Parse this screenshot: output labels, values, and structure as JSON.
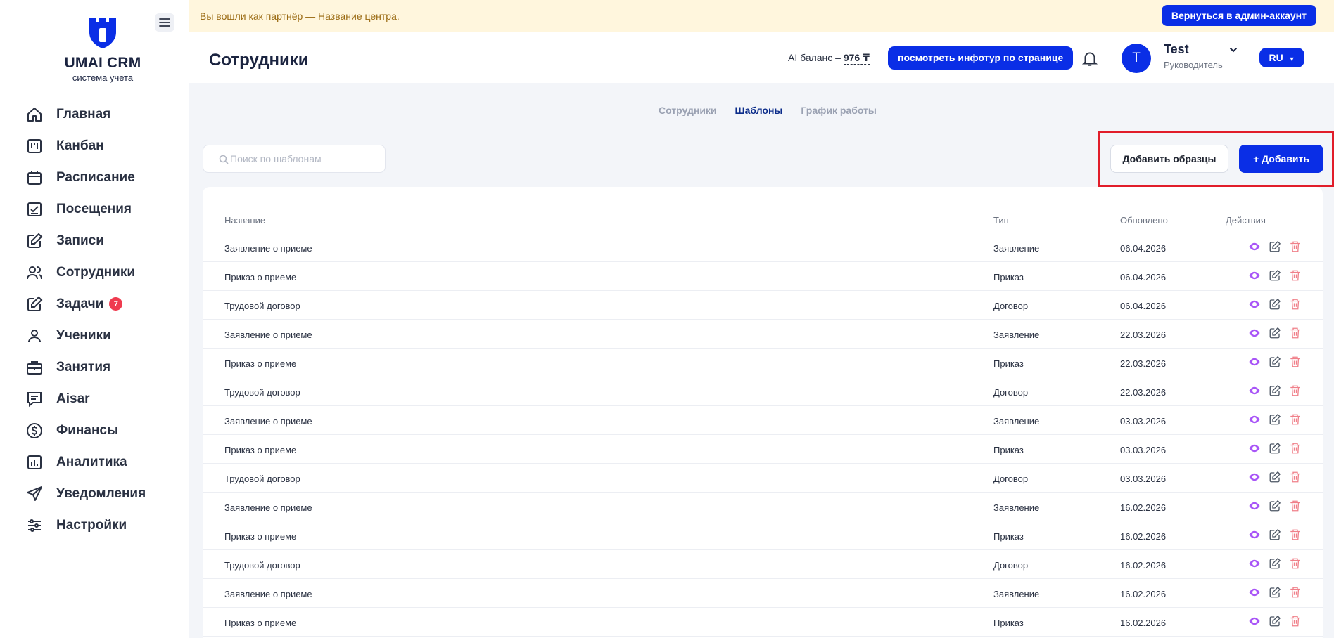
{
  "brand": {
    "title": "UMAI CRM",
    "subtitle": "система учета"
  },
  "sidebar": {
    "items": [
      {
        "label": "Главная",
        "icon": "home-icon"
      },
      {
        "label": "Канбан",
        "icon": "kanban-icon"
      },
      {
        "label": "Расписание",
        "icon": "calendar-icon"
      },
      {
        "label": "Посещения",
        "icon": "attendance-icon"
      },
      {
        "label": "Записи",
        "icon": "edit-note-icon"
      },
      {
        "label": "Сотрудники",
        "icon": "users-icon"
      },
      {
        "label": "Задачи",
        "icon": "tasks-icon",
        "badge": "7"
      },
      {
        "label": "Ученики",
        "icon": "user-icon"
      },
      {
        "label": "Занятия",
        "icon": "briefcase-icon"
      },
      {
        "label": "Aisar",
        "icon": "chat-icon"
      },
      {
        "label": "Финансы",
        "icon": "dollar-icon"
      },
      {
        "label": "Аналитика",
        "icon": "chart-icon"
      },
      {
        "label": "Уведомления",
        "icon": "send-icon"
      },
      {
        "label": "Настройки",
        "icon": "sliders-icon"
      }
    ]
  },
  "banner": {
    "text": "Вы вошли как партнёр — Название центра.",
    "button": "Вернуться в админ-аккаунт"
  },
  "header": {
    "title": "Сотрудники",
    "ai_balance_label": "AI баланс – ",
    "ai_balance_value": "976 ₸",
    "tour_button": "посмотреть инфотур по странице",
    "user_initial": "T",
    "user_name": "Test",
    "user_role": "Руководитель",
    "language": "RU"
  },
  "tabs": [
    {
      "label": "Сотрудники",
      "active": false
    },
    {
      "label": "Шаблоны",
      "active": true
    },
    {
      "label": "График работы",
      "active": false
    }
  ],
  "search": {
    "placeholder": "Поиск по шаблонам",
    "value": ""
  },
  "toolbar": {
    "samples_label": "Добавить образцы",
    "add_label": "+ Добавить"
  },
  "table": {
    "columns": [
      "Название",
      "Тип",
      "Обновлено",
      "Действия"
    ],
    "rows": [
      {
        "name": "Заявление о приеме",
        "type": "Заявление",
        "updated": "06.04.2026"
      },
      {
        "name": "Приказ о приеме",
        "type": "Приказ",
        "updated": "06.04.2026"
      },
      {
        "name": "Трудовой договор",
        "type": "Договор",
        "updated": "06.04.2026"
      },
      {
        "name": "Заявление о приеме",
        "type": "Заявление",
        "updated": "22.03.2026"
      },
      {
        "name": "Приказ о приеме",
        "type": "Приказ",
        "updated": "22.03.2026"
      },
      {
        "name": "Трудовой договор",
        "type": "Договор",
        "updated": "22.03.2026"
      },
      {
        "name": "Заявление о приеме",
        "type": "Заявление",
        "updated": "03.03.2026"
      },
      {
        "name": "Приказ о приеме",
        "type": "Приказ",
        "updated": "03.03.2026"
      },
      {
        "name": "Трудовой договор",
        "type": "Договор",
        "updated": "03.03.2026"
      },
      {
        "name": "Заявление о приеме",
        "type": "Заявление",
        "updated": "16.02.2026"
      },
      {
        "name": "Приказ о приеме",
        "type": "Приказ",
        "updated": "16.02.2026"
      },
      {
        "name": "Трудовой договор",
        "type": "Договор",
        "updated": "16.02.2026"
      },
      {
        "name": "Заявление о приеме",
        "type": "Заявление",
        "updated": "16.02.2026"
      },
      {
        "name": "Приказ о приеме",
        "type": "Приказ",
        "updated": "16.02.2026"
      }
    ]
  },
  "colors": {
    "primary": "#0a2ee6",
    "danger": "#ef3b4f",
    "view_icon": "#a855f7",
    "delete_icon": "#f0808a",
    "highlight": "#e11d2a"
  }
}
